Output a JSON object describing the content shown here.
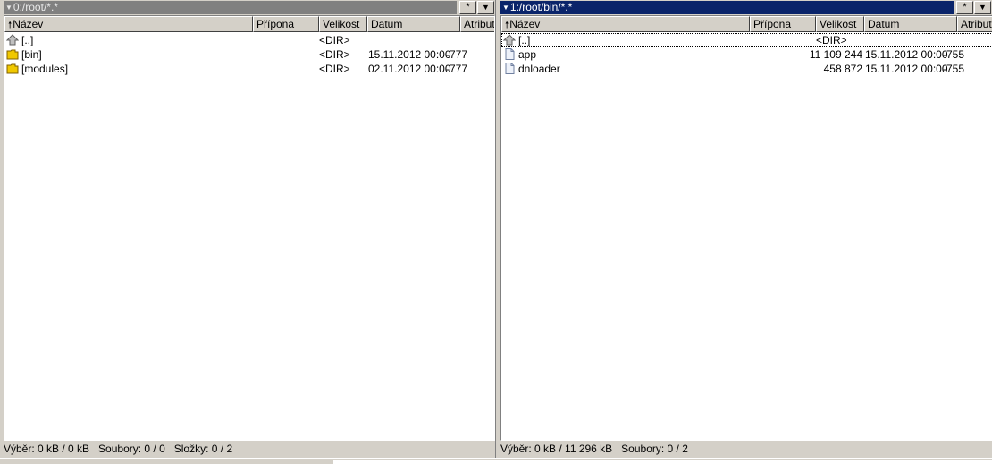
{
  "left_panel": {
    "path": "0:/root/*.*",
    "columns": {
      "name": "Název",
      "ext": "Přípona",
      "size": "Velikost",
      "date": "Datum",
      "attr": "Atribut"
    },
    "rows": [
      {
        "name": "[..]",
        "size": "<DIR>",
        "date": "",
        "attr": "",
        "icon": "up-arrow-icon"
      },
      {
        "name": "[bin]",
        "size": "<DIR>",
        "date": "15.11.2012 00:00",
        "attr": "-777",
        "icon": "folder-icon"
      },
      {
        "name": "[modules]",
        "size": "<DIR>",
        "date": "02.11.2012 00:00",
        "attr": "-777",
        "icon": "folder-icon"
      }
    ],
    "status": "Výběr: 0 kB / 0 kB   Soubory: 0 / 0   Složky: 0 / 2"
  },
  "right_panel": {
    "path": "1:/root/bin/*.*",
    "columns": {
      "name": "Název",
      "ext": "Přípona",
      "size": "Velikost",
      "date": "Datum",
      "attr": "Atribut"
    },
    "rows": [
      {
        "name": "[..]",
        "size": "<DIR>",
        "date": "",
        "attr": "",
        "icon": "up-arrow-icon"
      },
      {
        "name": "app",
        "size": "11 109 244",
        "date": "15.11.2012 00:00",
        "attr": "-755",
        "icon": "file-icon"
      },
      {
        "name": "dnloader",
        "size": "458 872",
        "date": "15.11.2012 00:00",
        "attr": "-755",
        "icon": "file-icon"
      }
    ],
    "status": "Výběr: 0 kB / 11 296 kB   Soubory: 0 / 2"
  },
  "buttons": {
    "star": "*",
    "dropdown": "▼"
  },
  "colors": {
    "active_path_bg": "#0a246a",
    "inactive_path_bg": "#808080",
    "folder": "#f0c800"
  }
}
